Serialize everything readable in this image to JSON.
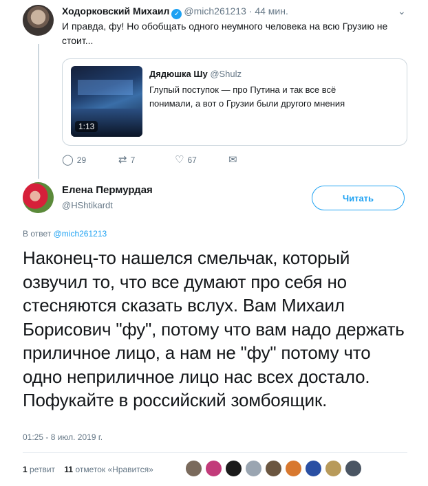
{
  "parent": {
    "name": "Ходорковский Михаил",
    "verified_glyph": "✓",
    "handle": "@mich261213",
    "time": "· 44 мин.",
    "more_glyph": "⌄",
    "text": "И правда, фу! Но обобщать одного неумного человека на всю Грузию не стоит...",
    "quote": {
      "name": "Дядюшка Шу",
      "handle": "@Shulz",
      "text": "Глупый поступок — про Путина и так все всё понимали, а вот о Грузии были другого мнения",
      "duration": "1:13"
    },
    "actions": {
      "reply_icon": "reply-icon",
      "reply_glyph": "◯",
      "reply_count": "29",
      "retweet_icon": "retweet-icon",
      "retweet_glyph": "⇄",
      "retweet_count": "7",
      "like_icon": "heart-icon",
      "like_glyph": "♡",
      "like_count": "67",
      "dm_icon": "envelope-icon",
      "dm_glyph": "✉"
    }
  },
  "main": {
    "name": "Елена Пермурдая",
    "handle": "@HShtikardt",
    "follow_label": "Читать",
    "reply_prefix": "В ответ",
    "reply_handle": "@mich261213",
    "text": "Наконец-то нашелся смельчак, который озвучил то, что все думают про себя но стесняются сказать вслух. Вам Михаил Борисович \"фу\", потому что вам надо держать приличное лицо, а нам не \"фу\" потому что одно неприличное лицо нас всех достало. Пофукайте в российский зомбоящик.",
    "timestamp": "01:25 - 8 июл. 2019 г.",
    "stats": {
      "retweets_count": "1",
      "retweets_label": "ретвит",
      "likes_count": "11",
      "likes_label": "отметок «Нравится»"
    },
    "likers": [
      {
        "color": "#7a6a5c"
      },
      {
        "color": "#c23b7a"
      },
      {
        "color": "#1b1b1b"
      },
      {
        "color": "#9aa5b1"
      },
      {
        "color": "#6b5640"
      },
      {
        "color": "#d8782f"
      },
      {
        "color": "#2a4fa3"
      },
      {
        "color": "#b89a5a"
      },
      {
        "color": "#4a5563"
      }
    ]
  },
  "colors": {
    "accent": "#1da1f2",
    "text": "#14171a",
    "muted": "#657786",
    "border": "#ccd6dd"
  }
}
